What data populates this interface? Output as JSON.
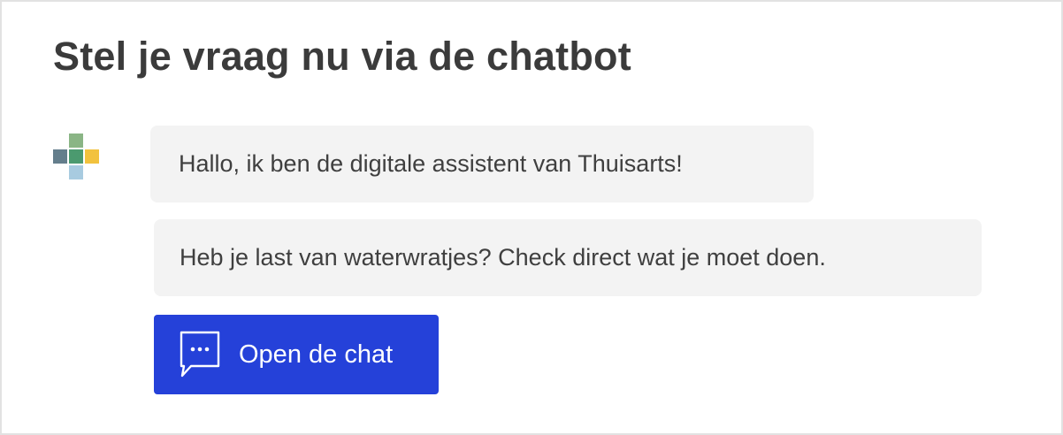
{
  "heading": "Stel je vraag nu via de chatbot",
  "logo": {
    "icon": "thuisarts-cross-logo-icon",
    "colors": {
      "top": "#8ab585",
      "left": "#647e8c",
      "center": "#4b9a6f",
      "right": "#f2c23e",
      "bottom": "#a8cbe0"
    }
  },
  "messages": [
    {
      "text": "Hallo, ik ben de digitale assistent van Thuisarts!"
    },
    {
      "text": "Heb je last van waterwratjes? Check direct wat je moet doen."
    }
  ],
  "chat_button": {
    "label": "Open de chat",
    "icon": "chat-bubble-icon",
    "color": "#2541d9"
  }
}
